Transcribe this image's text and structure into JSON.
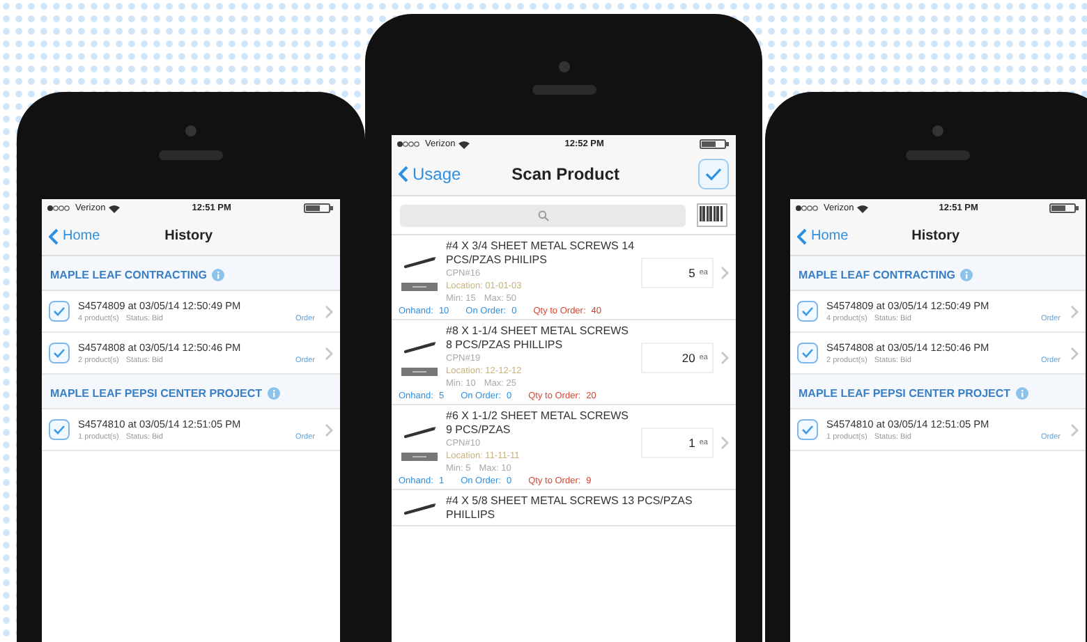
{
  "phones": [
    {
      "kind": "history",
      "status_bar": {
        "carrier": "Verizon",
        "time": "12:51 PM"
      },
      "nav": {
        "back": "Home",
        "title": "History"
      },
      "sections": [
        {
          "title": "MAPLE LEAF CONTRACTING",
          "items": [
            {
              "title": "S4574809 at 03/05/14 12:50:49 PM",
              "count": "4 product(s)",
              "status": "Status: Bid",
              "action": "Order",
              "checked": true
            },
            {
              "title": "S4574808 at 03/05/14 12:50:46 PM",
              "count": "2 product(s)",
              "status": "Status: Bid",
              "action": "Order",
              "checked": true
            }
          ]
        },
        {
          "title": "MAPLE LEAF PEPSI CENTER PROJECT",
          "items": [
            {
              "title": "S4574810 at 03/05/14 12:51:05 PM",
              "count": "1 product(s)",
              "status": "Status: Bid",
              "action": "Order",
              "checked": true
            }
          ]
        }
      ]
    },
    {
      "kind": "scan",
      "status_bar": {
        "carrier": "Verizon",
        "time": "12:52 PM"
      },
      "nav": {
        "back": "Usage",
        "title": "Scan Product"
      },
      "products": [
        {
          "name": "#4 X 3/4 SHEET METAL SCREWS 14 PCS/PZAS PHILIPS",
          "cpn": "CPN#16",
          "location": "Location: 01-01-03",
          "min": "Min: 15",
          "max": "Max: 50",
          "quantity": "5",
          "unit": "ea",
          "onhand_label": "Onhand:",
          "onhand": "10",
          "on_order_label": "On Order:",
          "on_order": "0",
          "to_order_label": "Qty to Order:",
          "to_order": "40"
        },
        {
          "name": "#8 X 1-1/4 SHEET METAL SCREWS 8 PCS/PZAS PHILLIPS",
          "cpn": "CPN#19",
          "location": "Location: 12-12-12",
          "min": "Min: 10",
          "max": "Max: 25",
          "quantity": "20",
          "unit": "ea",
          "onhand_label": "Onhand:",
          "onhand": "5",
          "on_order_label": "On Order:",
          "on_order": "0",
          "to_order_label": "Qty to Order:",
          "to_order": "20"
        },
        {
          "name": "#6 X 1-1/2 SHEET METAL SCREWS 9 PCS/PZAS",
          "cpn": "CPN#10",
          "location": "Location: 11-11-11",
          "min": "Min: 5",
          "max": "Max: 10",
          "quantity": "1",
          "unit": "ea",
          "onhand_label": "Onhand:",
          "onhand": "1",
          "on_order_label": "On Order:",
          "on_order": "0",
          "to_order_label": "Qty to Order:",
          "to_order": "9"
        },
        {
          "name": "#4 X 5/8 SHEET METAL SCREWS 13 PCS/PZAS PHILLIPS"
        }
      ]
    },
    {
      "kind": "history",
      "status_bar": {
        "carrier": "Verizon",
        "time": "12:51 PM"
      },
      "nav": {
        "back": "Home",
        "title": "History"
      },
      "sections": [
        {
          "title": "MAPLE LEAF CONTRACTING",
          "items": [
            {
              "title": "S4574809 at 03/05/14 12:50:49 PM",
              "count": "4 product(s)",
              "status": "Status: Bid",
              "action": "Order",
              "checked": true
            },
            {
              "title": "S4574808 at 03/05/14 12:50:46 PM",
              "count": "2 product(s)",
              "status": "Status: Bid",
              "action": "Order",
              "checked": true
            }
          ]
        },
        {
          "title": "MAPLE LEAF PEPSI CENTER PROJECT",
          "items": [
            {
              "title": "S4574810 at 03/05/14 12:51:05 PM",
              "count": "1 product(s)",
              "status": "Status: Bid",
              "action": "Order",
              "checked": true
            }
          ]
        }
      ]
    }
  ]
}
